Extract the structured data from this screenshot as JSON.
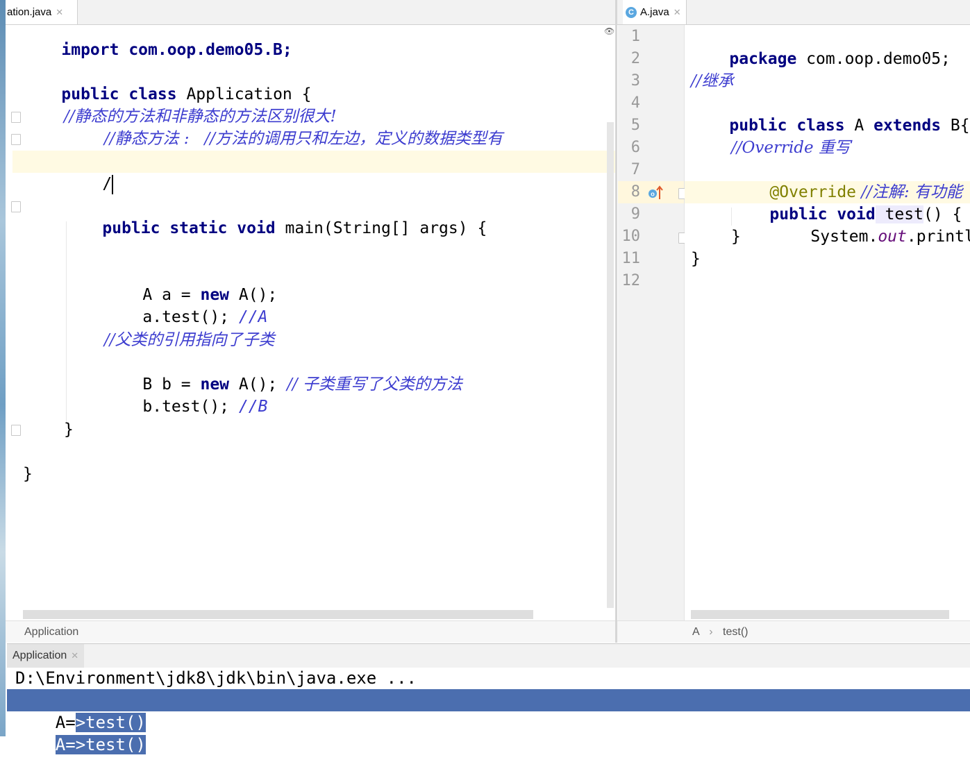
{
  "left_tab": {
    "label": "ation.java"
  },
  "right_tab": {
    "label": "A.java",
    "icon": "class-c-icon"
  },
  "left_editor": {
    "line_import": "import com.oop.demo05.B;",
    "line_class_kw1": "public",
    "line_class_kw2": "class",
    "line_class_rest": "Application {",
    "comment1": "//静态的方法和非静态的方法区别很大!",
    "comment2": "//静态方法 :   //方法的调用只和左边，定义的数据类型有",
    "typing": "/",
    "main_kw": "public static void",
    "main_rest": "main(String[] args) {",
    "a_decl_pre": "A a = ",
    "a_decl_new": "new",
    "a_decl_post": " A();",
    "a_test": "a.test(); ",
    "a_test_comment": "//A",
    "comment3": "//父类的引用指向了子类",
    "b_decl_pre": "B b = ",
    "b_decl_new": "new",
    "b_decl_post": " A(); ",
    "b_decl_comment": "// 子类重写了父类的方法",
    "b_test": "b.test(); ",
    "b_test_comment": "//B",
    "close_method": "}",
    "close_class": "}"
  },
  "left_breadcrumb": "Application",
  "right_editor": {
    "line_numbers": [
      "1",
      "2",
      "3",
      "4",
      "5",
      "6",
      "7",
      "8",
      "9",
      "10",
      "11",
      "12"
    ],
    "pkg_kw": "package",
    "pkg_rest": " com.oop.demo05;",
    "comment_inherit": "//继承",
    "class_kw": "public class",
    "class_name": " A ",
    "extends_kw": "extends",
    "class_rest": " B{",
    "comment_override": "//Override 重写",
    "annotation": "@Override",
    "annotation_comment": " //注解: 有功能",
    "method_kw": "public void",
    "method_name": " test",
    "method_rest": "() {",
    "println_pre": "System.",
    "println_out": "out",
    "println_post": ".println(",
    "close_method": "}",
    "close_class": "}"
  },
  "right_breadcrumb": {
    "class": "A",
    "separator": "›",
    "method": "test()"
  },
  "run_window": {
    "tab_label": "Application",
    "console_line1": "D:\\Environment\\jdk8\\jdk\\bin\\java.exe ...",
    "console_line2_a": "A=",
    "console_line2_b": ">test()",
    "console_line3": "A=>test()"
  },
  "colors": {
    "keyword": "#000080",
    "comment": "#3c3ccf",
    "annotation": "#808000",
    "selection": "#4b6eaf"
  }
}
